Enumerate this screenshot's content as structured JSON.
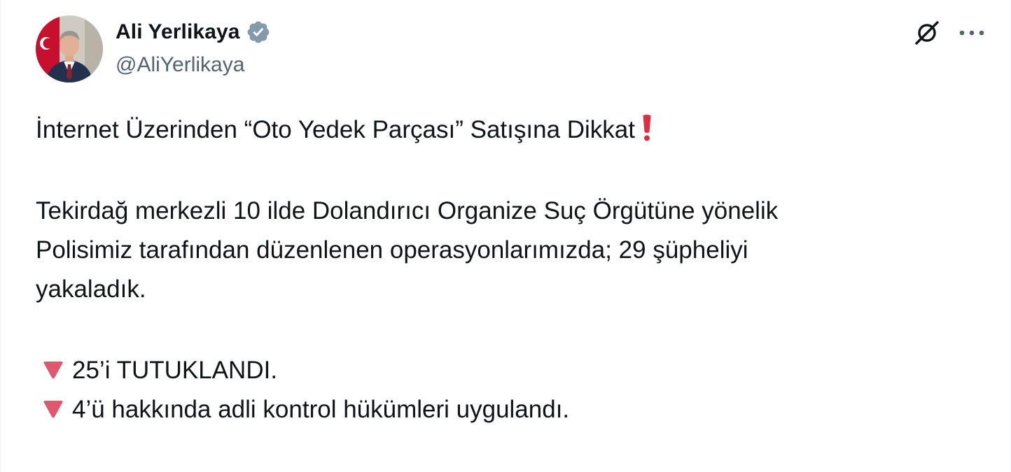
{
  "author": {
    "display_name": "Ali Yerlikaya",
    "handle": "@AliYerlikaya",
    "verified_icon": "verified-badge-icon",
    "avatar": "profile-photo"
  },
  "header_actions": {
    "grok_icon": "grok-icon",
    "more_icon": "more-dots-icon"
  },
  "tweet": {
    "title_line": "İnternet Üzerinden “Oto Yedek Parçası” Satışına Dikkat",
    "title_emoji": "exclamation-mark-icon",
    "body_lines": [
      "Tekirdağ merkezli 10 ilde Dolandırıcı Organize Suç Örgütüne yönelik",
      "Polisimiz tarafından düzenlenen operasyonlarımızda; 29 şüpheliyi",
      "yakaladık."
    ],
    "bullets": [
      {
        "icon": "red-down-triangle-icon",
        "text": "25’i TUTUKLANDI."
      },
      {
        "icon": "red-down-triangle-icon",
        "text": "4’ü hakkında adli kontrol hükümleri uygulandı."
      }
    ]
  },
  "colors": {
    "text": "#0f1419",
    "secondary": "#536471",
    "verified": "#829aab",
    "accent_red": "#dd2e44",
    "triangle_red": "#e0586e"
  }
}
